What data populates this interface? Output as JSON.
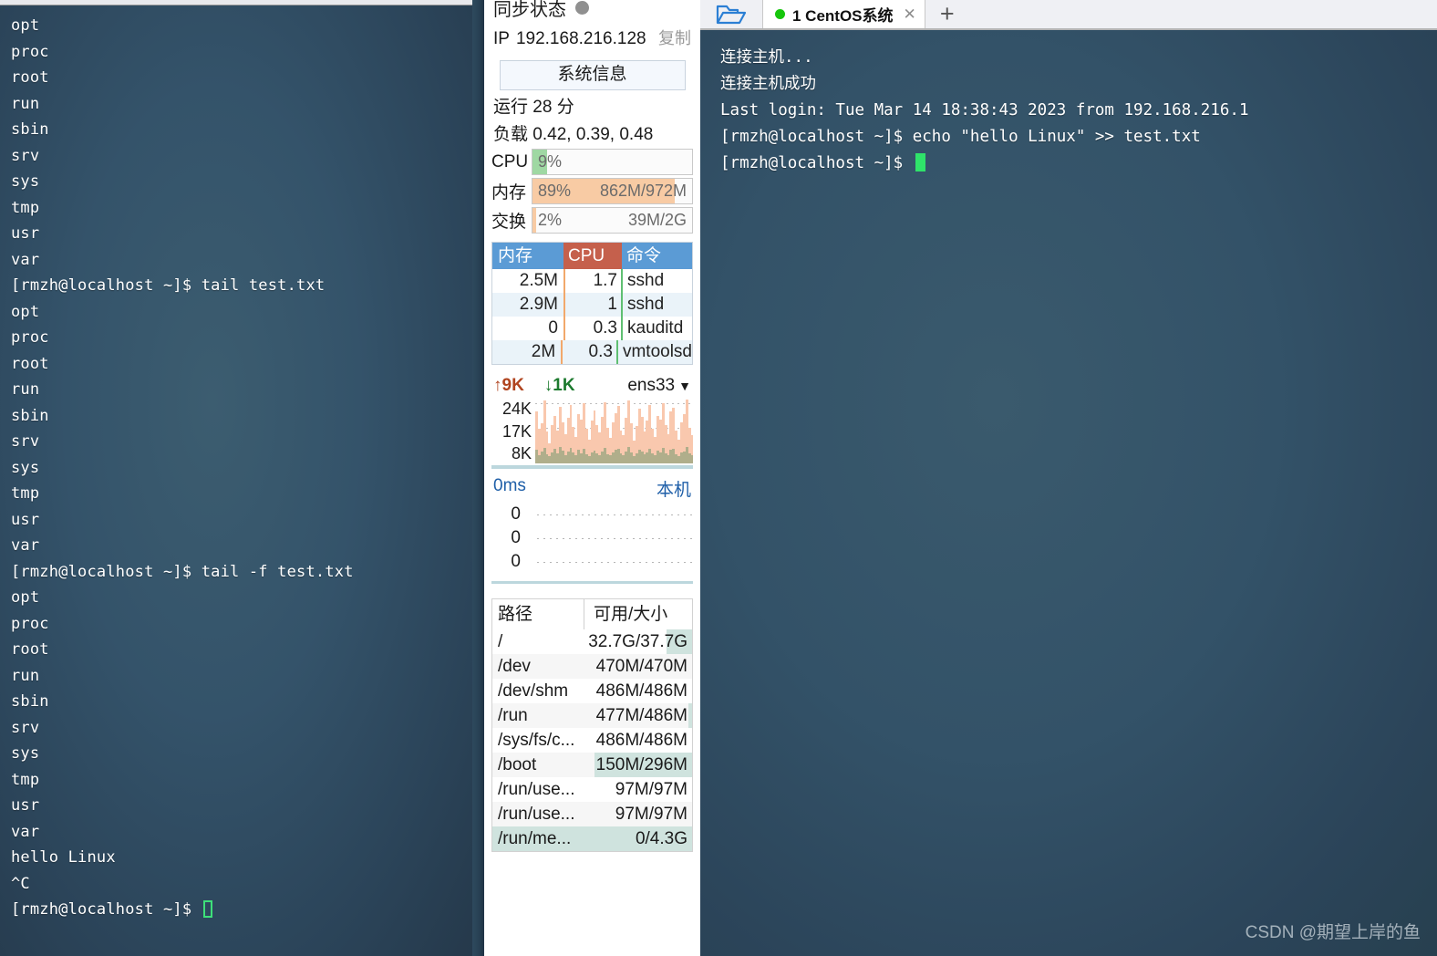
{
  "left_terminal": {
    "lines": [
      "opt",
      "proc",
      "root",
      "run",
      "sbin",
      "srv",
      "sys",
      "tmp",
      "usr",
      "var",
      "[rmzh@localhost ~]$ tail test.txt",
      "opt",
      "proc",
      "root",
      "run",
      "sbin",
      "srv",
      "sys",
      "tmp",
      "usr",
      "var",
      "[rmzh@localhost ~]$ tail -f test.txt",
      "opt",
      "proc",
      "root",
      "run",
      "sbin",
      "srv",
      "sys",
      "tmp",
      "usr",
      "var",
      "hello Linux",
      "^C",
      "[rmzh@localhost ~]$ "
    ]
  },
  "monitor": {
    "sync_label": "同步状态",
    "ip_label": "IP",
    "ip_value": "192.168.216.128",
    "copy_label": "复制",
    "sysinfo_button": "系统信息",
    "uptime": "运行 28 分",
    "load": "负载 0.42, 0.39, 0.48",
    "gauges": [
      {
        "label": "CPU",
        "percent": "9%",
        "detail": "",
        "fill_pct": 9,
        "color": "#9fd8a3"
      },
      {
        "label": "内存",
        "percent": "89%",
        "detail": "862M/972M",
        "fill_pct": 89,
        "color": "#f8cba4"
      },
      {
        "label": "交换",
        "percent": "2%",
        "detail": "39M/2G",
        "fill_pct": 2,
        "color": "#f8cba4"
      }
    ],
    "proc_table": {
      "headers": [
        "内存",
        "CPU",
        "命令"
      ],
      "rows": [
        {
          "mem": "2.5M",
          "cpu": "1.7",
          "cmd": "sshd"
        },
        {
          "mem": "2.9M",
          "cpu": "1",
          "cmd": "sshd"
        },
        {
          "mem": "0",
          "cpu": "0.3",
          "cmd": "kauditd"
        },
        {
          "mem": "2M",
          "cpu": "0.3",
          "cmd": "vmtoolsd"
        }
      ]
    },
    "network": {
      "upload": "9K",
      "download": "1K",
      "interface": "ens33",
      "y_axis": [
        "24K",
        "17K",
        "8K"
      ],
      "upload_series": [
        78,
        52,
        60,
        95,
        48,
        30,
        58,
        72,
        50,
        85,
        62,
        44,
        68,
        88,
        55,
        40,
        74,
        66,
        90,
        52,
        36,
        64,
        80,
        58,
        46,
        70,
        92,
        54,
        38,
        62,
        76,
        86,
        50,
        42,
        68,
        94,
        60,
        34,
        56,
        82,
        70,
        48,
        64,
        88,
        52,
        40,
        72,
        66,
        90,
        58,
        44,
        78,
        84,
        50,
        36,
        62,
        74,
        96,
        54,
        42
      ],
      "download_series": [
        16,
        10,
        14,
        18,
        11,
        8,
        13,
        17,
        12,
        19,
        15,
        9,
        14,
        18,
        13,
        10,
        16,
        12,
        17,
        11,
        8,
        13,
        15,
        12,
        10,
        14,
        18,
        11,
        9,
        13,
        16,
        17,
        12,
        10,
        14,
        19,
        13,
        8,
        12,
        16,
        14,
        11,
        13,
        17,
        12,
        9,
        15,
        13,
        18,
        12,
        10,
        16,
        17,
        11,
        8,
        13,
        14,
        19,
        12,
        10
      ]
    },
    "ping": {
      "latency": "0ms",
      "host": "本机",
      "rows": [
        "0",
        "0",
        "0"
      ]
    },
    "disk": {
      "headers": [
        "路径",
        "可用/大小"
      ],
      "rows": [
        {
          "path": "/",
          "size": "32.7G/37.7G",
          "usage_pct": 13
        },
        {
          "path": "/dev",
          "size": "470M/470M",
          "usage_pct": 0
        },
        {
          "path": "/dev/shm",
          "size": "486M/486M",
          "usage_pct": 0
        },
        {
          "path": "/run",
          "size": "477M/486M",
          "usage_pct": 2
        },
        {
          "path": "/sys/fs/c...",
          "size": "486M/486M",
          "usage_pct": 0
        },
        {
          "path": "/boot",
          "size": "150M/296M",
          "usage_pct": 49
        },
        {
          "path": "/run/use...",
          "size": "97M/97M",
          "usage_pct": 0
        },
        {
          "path": "/run/use...",
          "size": "97M/97M",
          "usage_pct": 0
        },
        {
          "path": "/run/me...",
          "size": "0/4.3G",
          "usage_pct": 100
        }
      ]
    }
  },
  "right_pane": {
    "folder_icon": "open-folder-icon",
    "tab": {
      "label": "1 CentOS系统",
      "close": "✕",
      "status_color": "#16c60c"
    },
    "new_tab_label": "+",
    "terminal_lines": [
      "连接主机...",
      "连接主机成功",
      "Last login: Tue Mar 14 18:38:43 2023 from 192.168.216.1",
      "[rmzh@localhost ~]$ echo \"hello Linux\" >> test.txt",
      "[rmzh@localhost ~]$ "
    ]
  },
  "watermark": "CSDN @期望上岸的鱼"
}
